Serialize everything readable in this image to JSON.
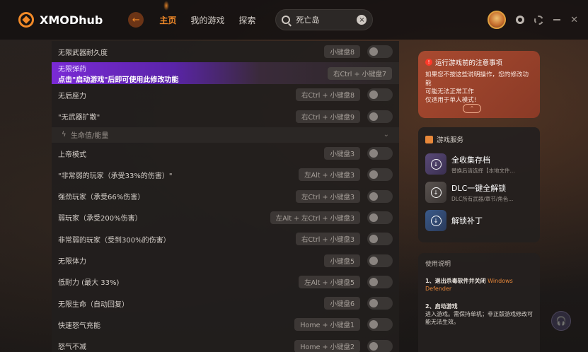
{
  "app": {
    "name": "XMODhub"
  },
  "nav": {
    "items": [
      "主页",
      "我的游戏",
      "探索"
    ],
    "active": 0
  },
  "search": {
    "value": "死亡岛"
  },
  "mods": [
    {
      "label": "无限武器耐久度",
      "hotkey": "小键盘8"
    },
    {
      "label": "无限弹药",
      "sub": "点击\"启动游戏\"后即可使用此修改功能",
      "hotkey": "右Ctrl + 小键盘7",
      "highlight": true
    },
    {
      "label": "无后座力",
      "hotkey": "右Ctrl + 小键盘8"
    },
    {
      "label": "\"无武器扩散\"",
      "hotkey": "右Ctrl + 小键盘9"
    }
  ],
  "section": {
    "title": "生命值/能量"
  },
  "mods2": [
    {
      "label": "上帝模式",
      "hotkey": "小键盘3"
    },
    {
      "label": "\"非常弱的玩家（承受33%的伤害）\"",
      "hotkey": "左Alt + 小键盘3"
    },
    {
      "label": "强劲玩家（承受66%伤害）",
      "hotkey": "左Ctrl + 小键盘3"
    },
    {
      "label": "弱玩家（承受200%伤害）",
      "hotkey": "左Alt + 左Ctrl + 小键盘3"
    },
    {
      "label": "非常弱的玩家（受到300%的伤害）",
      "hotkey": "右Ctrl + 小键盘3"
    },
    {
      "label": "无限体力",
      "hotkey": "小键盘5"
    },
    {
      "label": "低耐力 (最大 33%)",
      "hotkey": "左Alt + 小键盘5"
    },
    {
      "label": "无限生命（自动回复）",
      "hotkey": "小键盘6"
    },
    {
      "label": "快速怒气充能",
      "hotkey": "Home + 小键盘1"
    },
    {
      "label": "怒气不减",
      "hotkey": "Home + 小键盘2"
    }
  ],
  "notice": {
    "title": "运行游戏前的注意事项",
    "line1": "如果您不按这些说明操作，您的修改功能",
    "line2": "可能无法正常工作",
    "line3": "仅适用于单人模式!"
  },
  "services": {
    "title": "游戏服务",
    "items": [
      {
        "name": "全收集存档",
        "sub": "替换后请选择【本地文件..."
      },
      {
        "name": "DLC一键全解锁",
        "sub": "DLC所有武器/章节/角色..."
      },
      {
        "name": "解锁补丁",
        "sub": ""
      }
    ]
  },
  "guide": {
    "title": "使用说明",
    "step1": "1、退出杀毒软件并关闭",
    "step1_orange": "Windows Defender",
    "step2": "2、启动游戏",
    "step2_desc": "进入游戏。需保持单机；非正版游戏修改可能无法生效。"
  },
  "colors": {
    "accent": "#f28a28",
    "highlight": "#7a2ad6",
    "notice": "#a84a30"
  }
}
